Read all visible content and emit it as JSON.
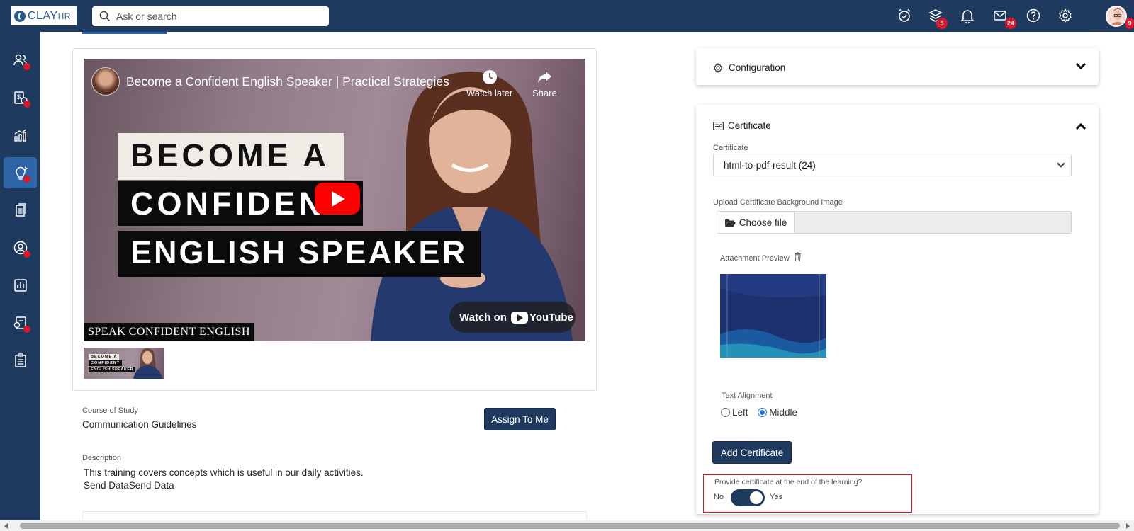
{
  "app": {
    "logo_text": "CLAY",
    "logo_sub": "HR"
  },
  "search": {
    "placeholder": "Ask or search"
  },
  "topbar": {
    "icons": [
      "alarm-clock-icon",
      "layers-icon",
      "bell-icon",
      "mail-icon",
      "help-icon",
      "gear-icon"
    ],
    "layers_badge": "5",
    "mail_badge": "24",
    "avatar_badge": "9"
  },
  "sidebar": {
    "items": [
      {
        "icon": "users-icon",
        "dot": true
      },
      {
        "icon": "money-clock-icon",
        "dot": true
      },
      {
        "icon": "analytics-icon",
        "dot": false
      },
      {
        "icon": "learning-icon",
        "dot": true,
        "active": true
      },
      {
        "icon": "documents-icon",
        "dot": false
      },
      {
        "icon": "user-circle-icon",
        "dot": true
      },
      {
        "icon": "report-icon",
        "dot": false
      },
      {
        "icon": "recruitment-icon",
        "dot": true
      },
      {
        "icon": "checklist-icon",
        "dot": false
      }
    ]
  },
  "video": {
    "title": "Become a Confident English Speaker | Practical Strategies",
    "watch_later": "Watch later",
    "share": "Share",
    "headline_1": "BECOME A",
    "headline_2": "CONFIDENT",
    "headline_3": "ENGLISH SPEAKER",
    "watch_on": "Watch on",
    "youtube": "YouTube",
    "tag": "SPEAK CONFIDENT ENGLISH",
    "thumb_1": "BECOME A",
    "thumb_2": "CONFIDENT",
    "thumb_3": "ENGLISH SPEAKER"
  },
  "course": {
    "label": "Course of Study",
    "value": "Communication Guidelines",
    "assign_button": "Assign To Me",
    "description_label": "Description",
    "description_line_1": "This training covers concepts which is useful in our daily activities.",
    "description_line_2": "Send DataSend Data"
  },
  "configuration": {
    "title": "Configuration"
  },
  "certificate": {
    "title": "Certificate",
    "select_label": "Certificate",
    "select_value": "html-to-pdf-result (24)",
    "upload_label": "Upload Certificate Background Image",
    "choose_file": "Choose file",
    "preview_label": "Attachment Preview",
    "alignment_label": "Text Alignment",
    "align_left": "Left",
    "align_middle": "Middle",
    "align_selected": "Middle",
    "add_button": "Add Certificate",
    "provide_label": "Provide certificate at the end of the learning?",
    "toggle_no": "No",
    "toggle_yes": "Yes",
    "toggle_on": true
  },
  "colors": {
    "nav": "#1f3a5f",
    "accent": "#2d65a6",
    "badge": "#e0152c",
    "highlight": "#e0152c"
  }
}
